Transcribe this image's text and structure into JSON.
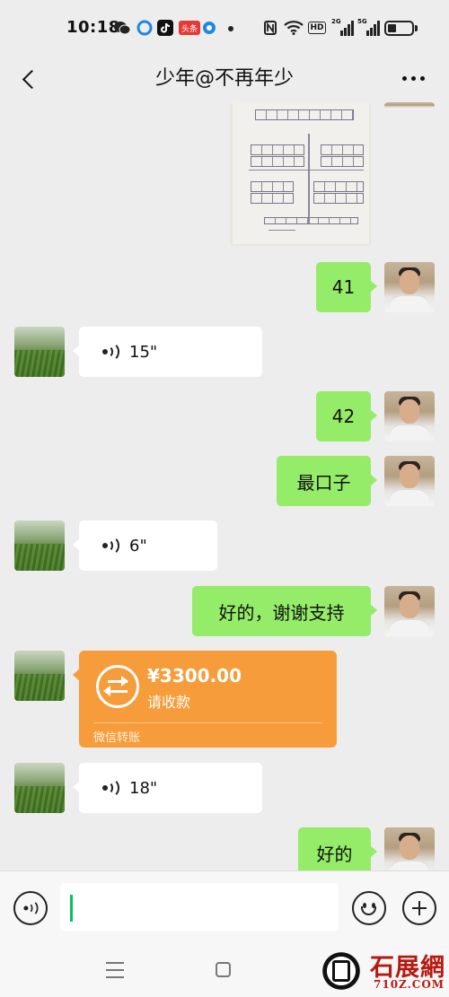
{
  "status_bar": {
    "time": "10:18",
    "app_badge": "头条",
    "wifi_badge": "HD",
    "signal_1": "2G",
    "signal_2": "5G"
  },
  "header": {
    "title": "少年@不再年少"
  },
  "messages": [
    {
      "from": "me",
      "type": "image"
    },
    {
      "from": "me",
      "type": "text",
      "text": "41"
    },
    {
      "from": "other",
      "type": "voice",
      "duration": "15\""
    },
    {
      "from": "me",
      "type": "text",
      "text": "42"
    },
    {
      "from": "me",
      "type": "text",
      "text": "最口子"
    },
    {
      "from": "other",
      "type": "voice",
      "duration": "6\""
    },
    {
      "from": "me",
      "type": "text",
      "text": "好的，谢谢支持"
    },
    {
      "from": "other",
      "type": "transfer",
      "amount": "¥3300.00",
      "status": "请收款",
      "footer": "微信转账"
    },
    {
      "from": "other",
      "type": "voice",
      "duration": "18\""
    },
    {
      "from": "me",
      "type": "text",
      "text": "好的"
    }
  ],
  "input": {
    "value": ""
  },
  "watermark": {
    "text": "石展網",
    "domain": "710Z.COM"
  },
  "colors": {
    "background": "#ededed",
    "my_bubble": "#95ec69",
    "other_bubble": "#ffffff",
    "transfer_card": "#f79c3a",
    "caret": "#07c160",
    "watermark": "#b51a12"
  }
}
